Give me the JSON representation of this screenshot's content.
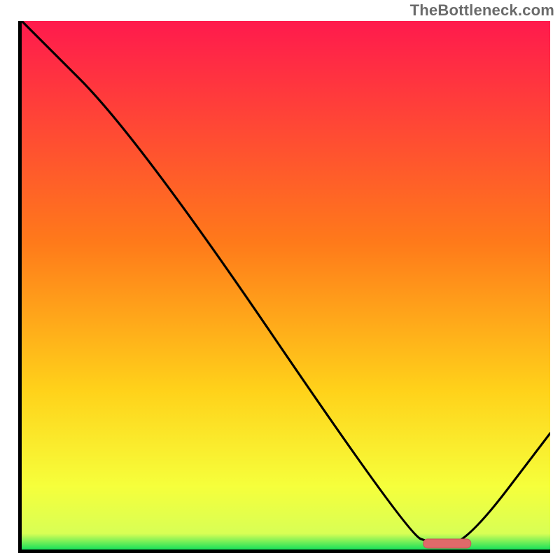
{
  "watermark": "TheBottleneck.com",
  "colors": {
    "grad_top": "#ff1a4d",
    "grad_mid1": "#ff7a1a",
    "grad_mid2": "#ffd21a",
    "grad_mid3": "#f6ff3b",
    "grad_bottom": "#18e05a",
    "axis": "#000000",
    "curve": "#000000",
    "marker_fill": "#e06a6a",
    "marker_stroke": "#c85454"
  },
  "chart_data": {
    "type": "line",
    "title": "",
    "xlabel": "",
    "ylabel": "",
    "xlim": [
      0,
      100
    ],
    "ylim": [
      0,
      100
    ],
    "x": [
      0,
      22,
      73,
      78,
      84,
      100
    ],
    "values": [
      100,
      78,
      3,
      1,
      1,
      22
    ],
    "optimum_marker": {
      "x_start": 76,
      "x_end": 85,
      "y": 1.2
    },
    "gradient_stops": [
      {
        "offset": 0,
        "color": "#ff1a4d"
      },
      {
        "offset": 42,
        "color": "#ff7a1a"
      },
      {
        "offset": 70,
        "color": "#ffd21a"
      },
      {
        "offset": 88,
        "color": "#f6ff3b"
      },
      {
        "offset": 97,
        "color": "#d8ff55"
      },
      {
        "offset": 100,
        "color": "#18e05a"
      }
    ]
  }
}
